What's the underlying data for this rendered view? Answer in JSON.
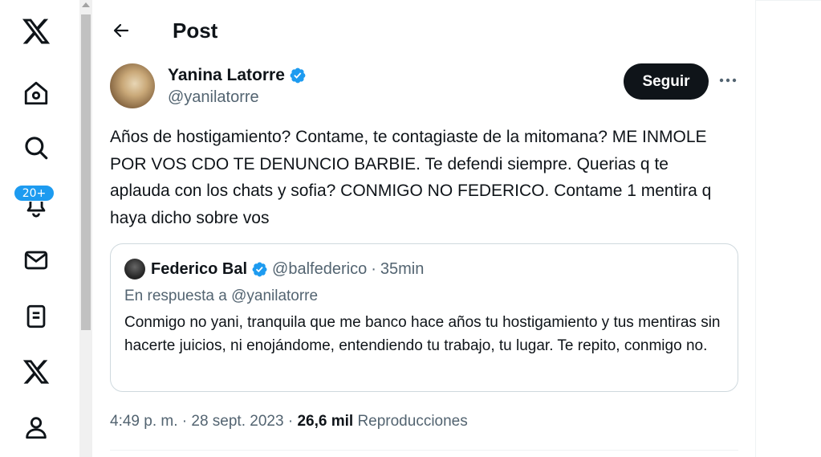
{
  "nav": {
    "items": [
      {
        "icon": "x-logo-icon"
      },
      {
        "icon": "home-icon"
      },
      {
        "icon": "search-icon"
      },
      {
        "icon": "bell-icon"
      },
      {
        "icon": "mail-icon"
      },
      {
        "icon": "list-icon"
      },
      {
        "icon": "x-premium-icon"
      },
      {
        "icon": "profile-icon"
      }
    ],
    "notifications_badge": "20+"
  },
  "header": {
    "title": "Post"
  },
  "post": {
    "author": {
      "name": "Yanina Latorre",
      "handle": "@yanilatorre",
      "verified": true
    },
    "follow_label": "Seguir",
    "text": "Años de hostigamiento? Contame, te contagiaste de la mitomana? ME INMOLE POR VOS CDO TE DENUNCIO BARBIE. Te defendi siempre. Querias q te aplauda con los chats y sofia? CONMIGO NO FEDERICO. Contame 1 mentira q haya dicho sobre vos",
    "time": "4:49 p. m.",
    "date": "28 sept. 2023",
    "views_count": "26,6 mil",
    "views_label": "Reproducciones",
    "separator": "·"
  },
  "quote": {
    "author": {
      "name": "Federico Bal",
      "handle": "@balfederico",
      "verified": true
    },
    "separator": "·",
    "time": "35min",
    "reply_to": "En respuesta a @yanilatorre",
    "text": "Conmigo no yani, tranquila que me banco hace años tu hostigamiento y tus mentiras sin hacerte juicios, ni enojándome, entendiendo tu trabajo, tu lugar. Te repito, conmigo no."
  },
  "colors": {
    "accent": "#1d9bf0",
    "text_primary": "#0f1419",
    "text_secondary": "#536471",
    "border": "#cfd9de"
  }
}
